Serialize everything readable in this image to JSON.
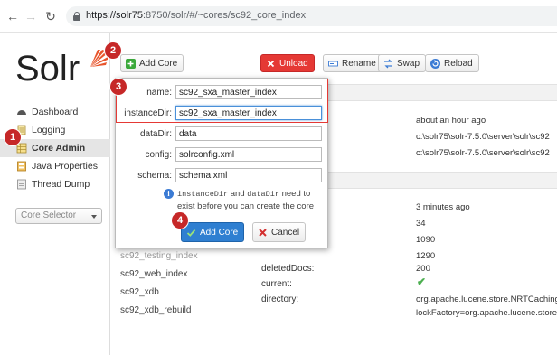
{
  "browser": {
    "url_host": "https://solr75",
    "url_rest": ":8750/solr/#/~cores/sc92_core_index"
  },
  "logo": {
    "text": "Solr"
  },
  "nav": {
    "items": [
      {
        "label": "Dashboard",
        "icon": "dashboard-icon"
      },
      {
        "label": "Logging",
        "icon": "logging-icon"
      },
      {
        "label": "Core Admin",
        "icon": "core-admin-icon",
        "active": true
      },
      {
        "label": "Java Properties",
        "icon": "java-icon"
      },
      {
        "label": "Thread Dump",
        "icon": "thread-dump-icon"
      }
    ],
    "core_selector": "Core Selector"
  },
  "toolbar": {
    "add_core": "Add Core",
    "unload": "Unload",
    "rename": "Rename",
    "swap": "Swap",
    "reload": "Reload"
  },
  "modal": {
    "fields": [
      {
        "label": "name:",
        "value": "sc92_sxa_master_index"
      },
      {
        "label": "instanceDir:",
        "value": "sc92_sxa_master_index"
      },
      {
        "label": "dataDir:",
        "value": "data"
      },
      {
        "label": "config:",
        "value": "solrconfig.xml"
      },
      {
        "label": "schema:",
        "value": "schema.xml"
      }
    ],
    "hint_code1": "instanceDir",
    "hint_and": " and ",
    "hint_code2": "dataDir",
    "hint_rest": " need to exist before you can create the core",
    "submit": "Add Core",
    "cancel": "Cancel"
  },
  "core_list": [
    "sc92_testing_index",
    "sc92_web_index",
    "sc92_xdb",
    "sc92_xdb_rebuild"
  ],
  "core_props": {
    "values_top": [
      "about an hour ago",
      "c:\\solr75\\solr-7.5.0\\server\\solr\\sc92",
      "c:\\solr75\\solr-7.5.0\\server\\solr\\sc92"
    ],
    "values_index": [
      "3 minutes ago",
      "34",
      "1090",
      "1290",
      "200"
    ],
    "labels": [
      "deletedDocs:",
      "current:",
      "directory:"
    ],
    "directory_line1": "org.apache.lucene.store.NRTCachingI",
    "directory_line2": "lockFactory=org.apache.lucene.store"
  },
  "steps": [
    "1",
    "2",
    "3",
    "4"
  ],
  "colors": {
    "accent_red": "#c62828",
    "primary_blue": "#2f7fd1",
    "unload_red": "#e53935"
  }
}
